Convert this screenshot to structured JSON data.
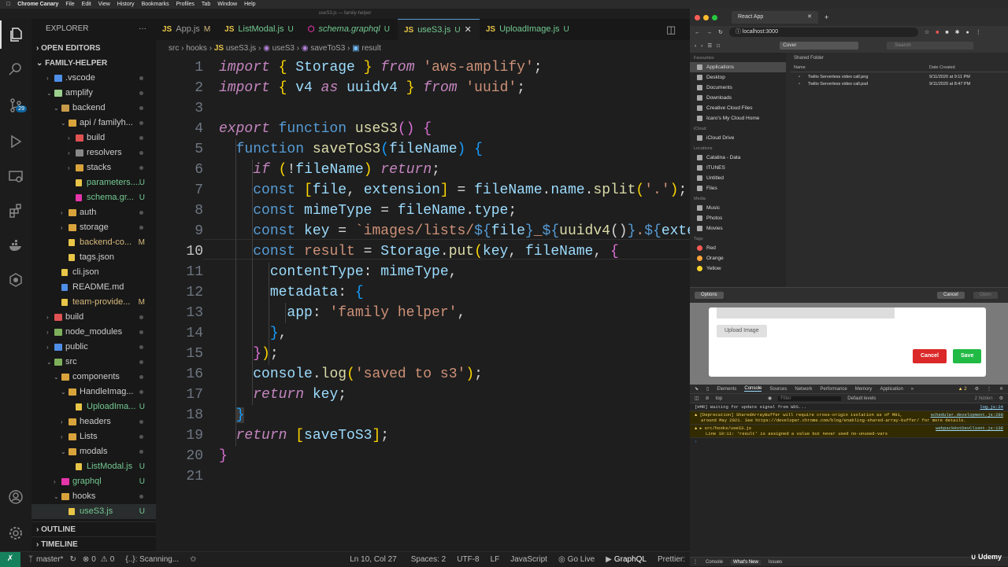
{
  "menubar": {
    "app": "Chrome Canary",
    "items": [
      "File",
      "Edit",
      "View",
      "History",
      "Bookmarks",
      "Profiles",
      "Tab",
      "Window",
      "Help"
    ]
  },
  "window_title": "useS3.js — family-helper",
  "sidebar": {
    "explorer": "EXPLORER",
    "open_editors": "OPEN EDITORS",
    "project": "FAMILY-HELPER",
    "outline": "OUTLINE",
    "timeline": "TIMELINE",
    "tree": [
      {
        "name": ".vscode",
        "status": ""
      },
      {
        "name": "amplify",
        "status": ""
      },
      {
        "name": "backend",
        "status": ""
      },
      {
        "name": "api / familyh...",
        "status": ""
      },
      {
        "name": "build",
        "status": ""
      },
      {
        "name": "resolvers",
        "status": ""
      },
      {
        "name": "stacks",
        "status": ""
      },
      {
        "name": "parameters....",
        "status": "U"
      },
      {
        "name": "schema.gr...",
        "status": "U"
      },
      {
        "name": "auth",
        "status": ""
      },
      {
        "name": "storage",
        "status": ""
      },
      {
        "name": "backend-co...",
        "status": "M"
      },
      {
        "name": "tags.json",
        "status": ""
      },
      {
        "name": "cli.json",
        "status": ""
      },
      {
        "name": "README.md",
        "status": ""
      },
      {
        "name": "team-provide...",
        "status": "M"
      },
      {
        "name": "build",
        "status": ""
      },
      {
        "name": "node_modules",
        "status": ""
      },
      {
        "name": "public",
        "status": ""
      },
      {
        "name": "src",
        "status": ""
      },
      {
        "name": "components",
        "status": ""
      },
      {
        "name": "HandleImag...",
        "status": ""
      },
      {
        "name": "UploadIma...",
        "status": "U"
      },
      {
        "name": "headers",
        "status": ""
      },
      {
        "name": "Lists",
        "status": ""
      },
      {
        "name": "modals",
        "status": ""
      },
      {
        "name": "ListModal.js",
        "status": "U"
      },
      {
        "name": "graphql",
        "status": "U"
      },
      {
        "name": "hooks",
        "status": ""
      },
      {
        "name": "useS3.js",
        "status": "U"
      }
    ],
    "badge": "29"
  },
  "tabs": [
    {
      "name": "App.js",
      "mark": "M"
    },
    {
      "name": "ListModal.js",
      "mark": "U"
    },
    {
      "name": "schema.graphql",
      "mark": "U"
    },
    {
      "name": "useS3.js",
      "mark": "U"
    },
    {
      "name": "UploadImage.js",
      "mark": "U"
    }
  ],
  "breadcrumb": [
    "src",
    "hooks",
    "useS3.js",
    "useS3",
    "saveToS3",
    "result"
  ],
  "editor": {
    "line_numbers": [
      "1",
      "2",
      "3",
      "4",
      "5",
      "6",
      "7",
      "8",
      "9",
      "10",
      "11",
      "12",
      "13",
      "14",
      "15",
      "16",
      "17",
      "18",
      "19",
      "20",
      "21"
    ],
    "current_line": "10"
  },
  "statusbar": {
    "branch": "master*",
    "errors": "0",
    "warnings": "0",
    "scanning": "{..}: Scanning...",
    "position": "Ln 10, Col 27",
    "spaces": "Spaces: 2",
    "encoding": "UTF-8",
    "eol": "LF",
    "language": "JavaScript",
    "golive": "Go Live",
    "graphql": "GraphQL",
    "prettier": "Prettier:"
  },
  "browser": {
    "tab_title": "React App",
    "url": "localhost:3000",
    "finder": {
      "location": "Cover",
      "search_placeholder": "Search",
      "folder_title": "Shared Folder",
      "col_name": "Name",
      "col_date": "Date Created",
      "favourites_label": "Favourites",
      "favourites": [
        "Applications",
        "Desktop",
        "Documents",
        "Downloads",
        "Creative Cloud Files",
        "Icaro's My Cloud Home"
      ],
      "icloud_label": "iCloud",
      "icloud": [
        "iCloud Drive"
      ],
      "locations_label": "Locations",
      "locations": [
        "Catalina - Data",
        "ITUNES",
        "Untitled",
        "Files"
      ],
      "media_label": "Media",
      "media": [
        "Music",
        "Photos",
        "Movies"
      ],
      "tags_label": "Tags",
      "tags": [
        {
          "name": "Red",
          "color": "#ff5b56"
        },
        {
          "name": "Orange",
          "color": "#ffa53a"
        },
        {
          "name": "Yellow",
          "color": "#ffd42a"
        }
      ],
      "files": [
        {
          "name": "Twilio Serverless video call.png",
          "date": "9/11/2020 at 9:11 PM"
        },
        {
          "name": "Twilio Serverless video call.psd",
          "date": "9/11/2020 at 8:47 PM"
        }
      ],
      "options": "Options",
      "cancel": "Cancel",
      "open": "Open"
    },
    "modal": {
      "upload": "Upload Image",
      "cancel": "Cancel",
      "save": "Save"
    },
    "devtools": {
      "tabs": [
        "Elements",
        "Console",
        "Sources",
        "Network",
        "Performance",
        "Memory",
        "Application"
      ],
      "warn_count": "2",
      "context": "top",
      "filter_placeholder": "Filter",
      "levels": "Default levels",
      "hidden": "2 hidden",
      "log1": "[HMR] Waiting for update signal from WDS...",
      "log1_src": "log.js:24",
      "warn1_a": "[Deprecation] SharedArrayBuffer will require cross-origin isolation as of M91,",
      "warn1_b": "around May 2021. See https://developer.chrome.com/blog/enabling-shared-array-buffer/ for more details.",
      "warn1_src": "scheduler.development.js:298",
      "warn2_a": "▸ src/hooks/useS3.js",
      "warn2_b": "Line 10:11:  'result' is assigned a value but never used  no-unused-vars",
      "warn2_src": "webpackHotDevClient.js:138",
      "drawer": [
        "Console",
        "What's New",
        "Issues"
      ]
    }
  },
  "watermark": "Udemy"
}
